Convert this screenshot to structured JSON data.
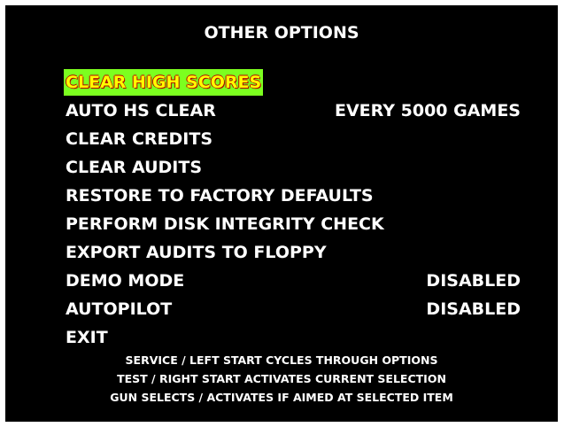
{
  "title": "OTHER OPTIONS",
  "colors": {
    "background": "#000000",
    "text": "#ffffff",
    "selected_background": "#7cff1f",
    "selected_text": "#ffff00"
  },
  "menu": [
    {
      "label": "CLEAR HIGH SCORES",
      "value": "",
      "selected": true
    },
    {
      "label": "AUTO HS CLEAR",
      "value": "EVERY 5000 GAMES",
      "selected": false
    },
    {
      "label": "CLEAR CREDITS",
      "value": "",
      "selected": false
    },
    {
      "label": "CLEAR AUDITS",
      "value": "",
      "selected": false
    },
    {
      "label": "RESTORE TO FACTORY DEFAULTS",
      "value": "",
      "selected": false
    },
    {
      "label": "PERFORM DISK INTEGRITY CHECK",
      "value": "",
      "selected": false
    },
    {
      "label": "EXPORT AUDITS TO FLOPPY",
      "value": "",
      "selected": false
    },
    {
      "label": "DEMO MODE",
      "value": "DISABLED",
      "selected": false
    },
    {
      "label": "AUTOPILOT",
      "value": "DISABLED",
      "selected": false
    },
    {
      "label": "EXIT",
      "value": "",
      "selected": false
    }
  ],
  "instructions": [
    "SERVICE / LEFT START CYCLES THROUGH OPTIONS",
    "TEST / RIGHT START ACTIVATES CURRENT SELECTION",
    "GUN SELECTS / ACTIVATES IF AIMED AT SELECTED ITEM"
  ]
}
